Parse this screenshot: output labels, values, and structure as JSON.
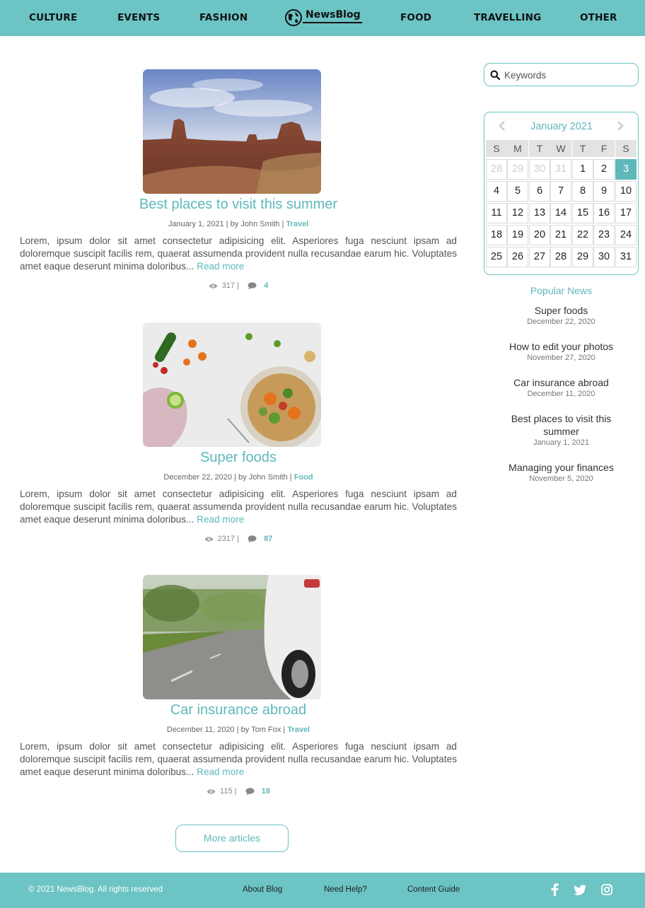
{
  "nav": {
    "items": [
      "CULTURE",
      "EVENTS",
      "FASHION",
      "FOOD",
      "TRAVELLING",
      "OTHER"
    ],
    "logo": "NewsBlog"
  },
  "articles": [
    {
      "image": "desert-mesa-landscape",
      "title": "Best places to visit this summer",
      "date": "January 1, 2021",
      "author": "by John Smith",
      "category": "Travel",
      "excerpt": "Lorem, ipsum dolor sit amet consectetur adipisicing elit. Asperiores fuga nesciunt ipsam ad doloremque suscipit facilis rem, quaerat assumenda provident nulla recusandae earum hic. Voluptates amet eaque deserunt minima doloribus...",
      "read_more": "Read more",
      "views": "317",
      "comments": "4"
    },
    {
      "image": "vegetable-bowl",
      "title": "Super foods",
      "date": "December 22, 2020",
      "author": "by John Smith",
      "category": "Food",
      "excerpt": "Lorem, ipsum dolor sit amet consectetur adipisicing elit. Asperiores fuga nesciunt ipsam ad doloremque suscipit facilis rem, quaerat assumenda provident nulla recusandae earum hic. Voluptates amet eaque deserunt minima doloribus...",
      "read_more": "Read more",
      "views": "2317",
      "comments": "87"
    },
    {
      "image": "car-on-road",
      "title": "Car insurance abroad",
      "date": "December 11, 2020",
      "author": "by Tom Fox",
      "category": "Travel",
      "excerpt": "Lorem, ipsum dolor sit amet consectetur adipisicing elit. Asperiores fuga nesciunt ipsam ad doloremque suscipit facilis rem, quaerat assumenda provident nulla recusandae earum hic. Voluptates amet eaque deserunt minima doloribus...",
      "read_more": "Read more",
      "views": "115",
      "comments": "18"
    }
  ],
  "more_articles": "More articles",
  "sidebar": {
    "search": {
      "placeholder": "Keywords",
      "value": ""
    },
    "calendar": {
      "title": "January 2021",
      "weekdays": [
        "S",
        "M",
        "T",
        "W",
        "T",
        "F",
        "S"
      ],
      "weeks": [
        [
          "28",
          "29",
          "30",
          "31",
          "1",
          "2",
          "3"
        ],
        [
          "4",
          "5",
          "6",
          "7",
          "8",
          "9",
          "10"
        ],
        [
          "11",
          "12",
          "13",
          "14",
          "15",
          "16",
          "17"
        ],
        [
          "18",
          "19",
          "20",
          "21",
          "22",
          "23",
          "24"
        ],
        [
          "25",
          "26",
          "27",
          "28",
          "29",
          "30",
          "31"
        ]
      ],
      "muted": [
        "0-0",
        "0-1",
        "0-2",
        "0-3"
      ],
      "selected": "0-6"
    },
    "popular": {
      "title": "Popular News",
      "items": [
        {
          "name": "Super foods",
          "date": "December 22, 2020"
        },
        {
          "name": "How to edit your photos",
          "date": "November 27, 2020"
        },
        {
          "name": "Car insurance abroad",
          "date": "December 11, 2020"
        },
        {
          "name": "Best places to visit this summer",
          "date": "January 1, 2021"
        },
        {
          "name": "Managing your finances",
          "date": "November 5, 2020"
        }
      ]
    }
  },
  "footer": {
    "copyright": "© 2021 NewsBlog. All rights reserved",
    "links": [
      "About Blog",
      "Need Help?",
      "Content Guide"
    ],
    "social": [
      "facebook-icon",
      "twitter-icon",
      "instagram-icon"
    ]
  },
  "colors": {
    "accent": "#6cc4c4",
    "accent_text": "#5fb8ba"
  }
}
